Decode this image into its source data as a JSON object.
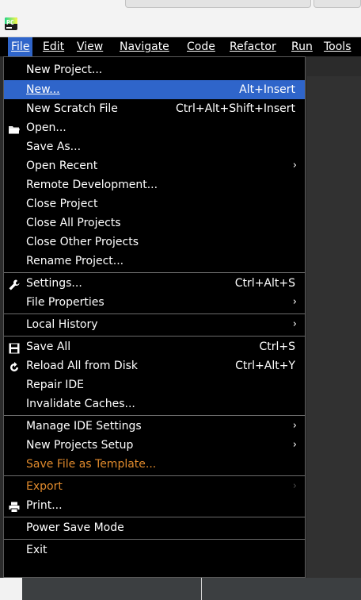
{
  "menubar": {
    "items": [
      "File",
      "Edit",
      "View",
      "Navigate",
      "Code",
      "Refactor",
      "Run",
      "Tools"
    ]
  },
  "file_menu": {
    "new_project": "New Project...",
    "new": "New...",
    "new_shortcut": "Alt+Insert",
    "new_scratch": "New Scratch File",
    "new_scratch_shortcut": "Ctrl+Alt+Shift+Insert",
    "open": "Open...",
    "save_as": "Save As...",
    "open_recent": "Open Recent",
    "remote_dev": "Remote Development...",
    "close_project": "Close Project",
    "close_all": "Close All Projects",
    "close_other": "Close Other Projects",
    "rename_project": "Rename Project...",
    "settings": "Settings...",
    "settings_shortcut": "Ctrl+Alt+S",
    "file_properties": "File Properties",
    "local_history": "Local History",
    "save_all": "Save All",
    "save_all_shortcut": "Ctrl+S",
    "reload": "Reload All from Disk",
    "reload_shortcut": "Ctrl+Alt+Y",
    "repair_ide": "Repair IDE",
    "invalidate_caches": "Invalidate Caches...",
    "manage_settings": "Manage IDE Settings",
    "new_projects_setup": "New Projects Setup",
    "save_template": "Save File as Template...",
    "export": "Export",
    "print": "Print...",
    "power_save": "Power Save Mode",
    "exit": "Exit"
  },
  "colors": {
    "menu_bg": "#000000",
    "selection": "#2f65ca",
    "accent_text": "#e08a2c"
  },
  "icons": {
    "logo": "pycharm-logo-icon",
    "open": "folder-icon",
    "settings": "wrench-icon",
    "save_all": "floppy-disk-icon",
    "reload": "reload-icon",
    "print": "printer-icon",
    "submenu": "chevron-right-icon"
  }
}
